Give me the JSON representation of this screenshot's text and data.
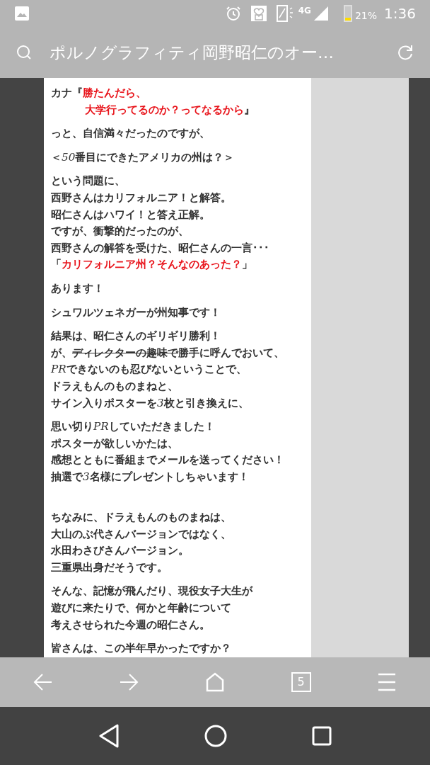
{
  "status_bar": {
    "network": "4G",
    "battery": {
      "percent": "21%",
      "level": 0.21
    },
    "time": "1:36"
  },
  "address_bar": {
    "title": "ポルノグラフィティ岡野昭仁のオー…"
  },
  "article": {
    "paragraphs": [
      {
        "blank_line_before": false,
        "lines": [
          {
            "indent": false,
            "segments": [
              {
                "kind": "plain",
                "text": "カナ『"
              },
              {
                "kind": "red",
                "text": "勝たんだら、"
              }
            ]
          },
          {
            "indent": true,
            "segments": [
              {
                "kind": "red",
                "text": "大学行ってるのか？ってなるから"
              },
              {
                "kind": "plain",
                "text": "』"
              }
            ]
          }
        ]
      },
      {
        "blank_line_before": false,
        "lines": [
          {
            "indent": false,
            "segments": [
              {
                "kind": "plain",
                "text": "っと、自信満々だったのですが、"
              }
            ]
          }
        ]
      },
      {
        "blank_line_before": false,
        "lines": [
          {
            "indent": false,
            "segments": [
              {
                "kind": "plain",
                "text": "＜"
              },
              {
                "kind": "italic",
                "text": "50"
              },
              {
                "kind": "plain",
                "text": "番目にできたアメリカの州は？＞"
              }
            ]
          }
        ]
      },
      {
        "blank_line_before": false,
        "lines": [
          {
            "indent": false,
            "segments": [
              {
                "kind": "plain",
                "text": "という問題に、"
              }
            ]
          },
          {
            "indent": false,
            "segments": [
              {
                "kind": "plain",
                "text": "西野さんはカリフォルニア！と解答。"
              }
            ]
          },
          {
            "indent": false,
            "segments": [
              {
                "kind": "plain",
                "text": "昭仁さんはハワイ！と答え正解。"
              }
            ]
          },
          {
            "indent": false,
            "segments": [
              {
                "kind": "plain",
                "text": "ですが、衝撃的だったのが、"
              }
            ]
          },
          {
            "indent": false,
            "segments": [
              {
                "kind": "plain",
                "text": "西野さんの解答を受けた、昭仁さんの一言･･･"
              }
            ]
          },
          {
            "indent": false,
            "segments": [
              {
                "kind": "plain",
                "text": "「"
              },
              {
                "kind": "red",
                "text": "カリフォルニア州？そんなのあった？"
              },
              {
                "kind": "plain",
                "text": "」"
              }
            ]
          }
        ]
      },
      {
        "blank_line_before": false,
        "lines": [
          {
            "indent": false,
            "segments": [
              {
                "kind": "plain",
                "text": "あります！"
              }
            ]
          }
        ]
      },
      {
        "blank_line_before": false,
        "lines": [
          {
            "indent": false,
            "segments": [
              {
                "kind": "plain",
                "text": "シュワルツェネガーが州知事です！"
              }
            ]
          }
        ]
      },
      {
        "blank_line_before": false,
        "lines": [
          {
            "indent": false,
            "segments": [
              {
                "kind": "plain",
                "text": "結果は、昭仁さんのギリギリ勝利！"
              }
            ]
          },
          {
            "indent": false,
            "segments": [
              {
                "kind": "plain",
                "text": "が、"
              },
              {
                "kind": "strike",
                "text": "ディレクターの趣味で"
              },
              {
                "kind": "plain",
                "text": "勝手に呼んでおいて、"
              }
            ]
          },
          {
            "indent": false,
            "segments": [
              {
                "kind": "italic",
                "text": "PR"
              },
              {
                "kind": "plain",
                "text": "できないのも忍びないということで、"
              }
            ]
          },
          {
            "indent": false,
            "segments": [
              {
                "kind": "plain",
                "text": "ドラえもんのものまねと、"
              }
            ]
          },
          {
            "indent": false,
            "segments": [
              {
                "kind": "plain",
                "text": "サイン入りポスターを"
              },
              {
                "kind": "italic",
                "text": "3"
              },
              {
                "kind": "plain",
                "text": "枚と引き換えに、"
              }
            ]
          }
        ]
      },
      {
        "blank_line_before": false,
        "lines": [
          {
            "indent": false,
            "segments": [
              {
                "kind": "plain",
                "text": "思い切り"
              },
              {
                "kind": "italic",
                "text": "PR"
              },
              {
                "kind": "plain",
                "text": "していただきました！"
              }
            ]
          },
          {
            "indent": false,
            "segments": [
              {
                "kind": "plain",
                "text": "ポスターが欲しいかたは、"
              }
            ]
          },
          {
            "indent": false,
            "segments": [
              {
                "kind": "plain",
                "text": "感想とともに番組までメールを送ってください！"
              }
            ]
          },
          {
            "indent": false,
            "segments": [
              {
                "kind": "plain",
                "text": "抽選で"
              },
              {
                "kind": "italic",
                "text": "3"
              },
              {
                "kind": "plain",
                "text": "名様にプレゼントしちゃいます！"
              }
            ]
          }
        ]
      },
      {
        "blank_line_before": true,
        "lines": [
          {
            "indent": false,
            "segments": [
              {
                "kind": "plain",
                "text": "ちなみに、ドラえもんのものまねは、"
              }
            ]
          },
          {
            "indent": false,
            "segments": [
              {
                "kind": "plain",
                "text": "大山のぶ代さんバージョンではなく、"
              }
            ]
          },
          {
            "indent": false,
            "segments": [
              {
                "kind": "plain",
                "text": "水田わさびさんバージョン。"
              }
            ]
          },
          {
            "indent": false,
            "segments": [
              {
                "kind": "plain",
                "text": "三重県出身だそうです。"
              }
            ]
          }
        ]
      },
      {
        "blank_line_before": false,
        "lines": [
          {
            "indent": false,
            "segments": [
              {
                "kind": "plain",
                "text": "そんな、記憶が飛んだり、現役女子大生が"
              }
            ]
          },
          {
            "indent": false,
            "segments": [
              {
                "kind": "plain",
                "text": "遊びに来たりで、何かと年齢について"
              }
            ]
          },
          {
            "indent": false,
            "segments": [
              {
                "kind": "plain",
                "text": "考えさせられた今週の昭仁さん。"
              }
            ]
          }
        ]
      },
      {
        "blank_line_before": false,
        "lines": [
          {
            "indent": false,
            "segments": [
              {
                "kind": "plain",
                "text": "皆さんは、この半年早かったですか？"
              }
            ]
          }
        ]
      }
    ]
  },
  "toolbar": {
    "tab_count": "5"
  }
}
